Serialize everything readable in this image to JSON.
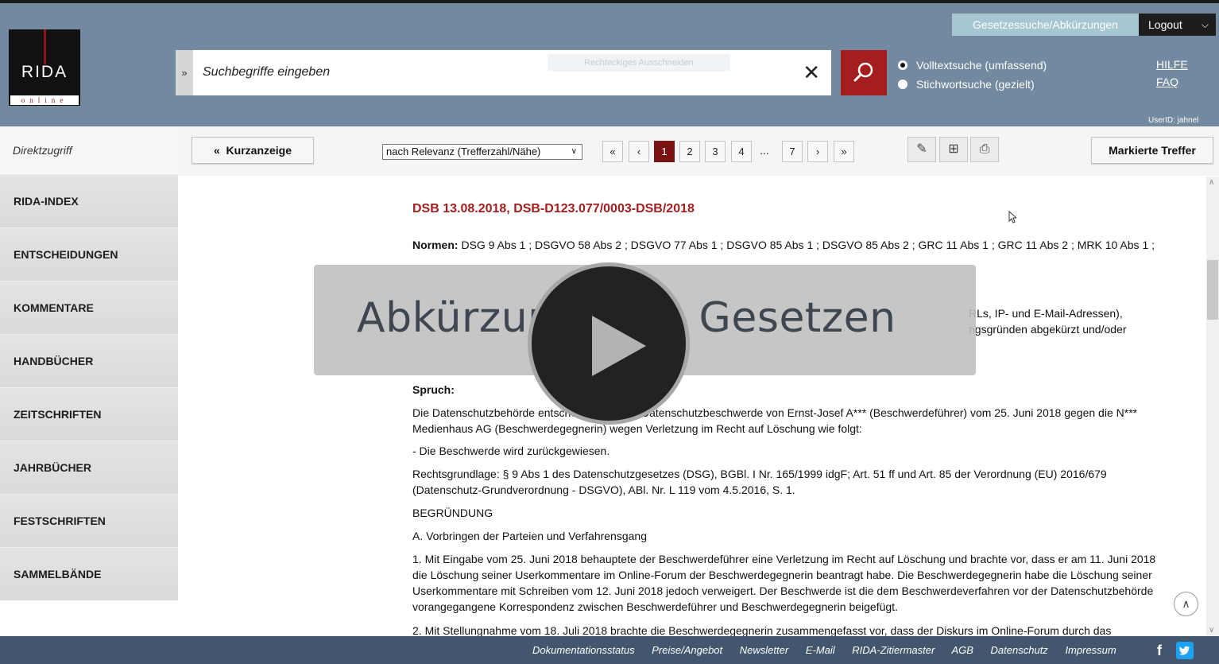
{
  "header": {
    "logo": {
      "word": "RIDA",
      "sub": "online"
    },
    "tab_gesetz": "Gesetzessuche/Abkürzungen",
    "logout": "Logout",
    "search_placeholder": "Suchbegriffe eingeben",
    "snip_label": "Rechteckiges Ausschneiden",
    "radio_full": "Volltextsuche (umfassend)",
    "radio_keyword": "Stichwortsuche (gezielt)",
    "hilfe": "HILFE",
    "faq": "FAQ",
    "userid": "UserID: jahnel"
  },
  "sidebar": {
    "direct": "Direktzugriff",
    "items": [
      "RIDA-INDEX",
      "ENTSCHEIDUNGEN",
      "KOMMENTARE",
      "HANDBÜCHER",
      "ZEITSCHRIFTEN",
      "JAHRBÜCHER",
      "FESTSCHRIFTEN",
      "SAMMELBÄNDE"
    ]
  },
  "toolbar": {
    "kurzanzeige": "Kurzanzeige",
    "sort": "nach Relevanz (Trefferzahl/Nähe)",
    "pages": [
      "1",
      "2",
      "3",
      "4",
      "7"
    ],
    "dots": "...",
    "markierte": "Markierte Treffer"
  },
  "document": {
    "title": "DSB 13.08.2018, DSB-D123.077/0003-DSB/2018",
    "normen_label": "Normen:",
    "normen": "DSG 9 Abs 1 ; DSGVO 58 Abs 2 ; DSGVO 77 Abs 1 ; DSGVO 85 Abs 1 ; DSGVO 85 Abs 2 ; GRC 11 Abs 1 ; GRC 11 Abs 2 ; MRK 10 Abs 1 ;",
    "hidden_line1": "RLs, IP- und E-Mail-Adressen),",
    "hidden_line2": "ngsgründen abgekürzt und/oder",
    "spruch": "Spruch:",
    "spruch_text": "Die Datenschutzbehörde entscheidet über die Datenschutzbeschwerde von Ernst-Josef A*** (Beschwerdeführer) vom 25. Juni 2018 gegen die N*** Medienhaus AG (Beschwerdegegnerin) wegen Verletzung im Recht auf Löschung wie folgt:",
    "beschwerde": "- Die Beschwerde wird zurückgewiesen.",
    "rechtsgrundlage": "Rechtsgrundlage: § 9 Abs 1 des Datenschutzgesetzes (DSG), BGBl. I Nr. 165/1999 idgF; Art. 51 ff und Art. 85 der Verordnung (EU) 2016/679 (Datenschutz-Grundverordnung - DSGVO), ABl. Nr. L 119 vom 4.5.2016, S. 1.",
    "begruendung": "BEGRÜNDUNG",
    "vorbringen": "A. Vorbringen der Parteien und Verfahrensgang",
    "para1": "1. Mit Eingabe vom 25. Juni 2018 behauptete der Beschwerdeführer eine Verletzung im Recht auf Löschung und brachte vor, dass er am 11. Juni 2018 die Löschung seiner Userkommentare im Online-Forum der Beschwerdegegnerin beantragt habe. Die Beschwerdegegnerin habe die Löschung seiner Userkommentare mit Schreiben vom 12. Juni 2018 jedoch verweigert. Der Beschwerde ist die dem Beschwerdeverfahren vor der Datenschutzbehörde vorangegangene Korrespondenz zwischen Beschwerdeführer und Beschwerdegegnerin beigefügt.",
    "para2": "2. Mit Stellungnahme vom 18. Juli 2018 brachte die Beschwerdegegnerin zusammengefasst vor, dass der Diskurs im Online-Forum durch das"
  },
  "overlay": {
    "title": "Abkürzungen in Gesetzen"
  },
  "footer": {
    "links": [
      "Dokumentationsstatus",
      "Preise/Angebot",
      "Newsletter",
      "E-Mail",
      "RIDA-Zitiermaster",
      "AGB",
      "Datenschutz",
      "Impressum"
    ]
  },
  "colors": {
    "header": "#7389a0",
    "accent_red": "#a51e1e",
    "footer": "#42576d",
    "tab_gesetz": "#a6c6d1"
  }
}
